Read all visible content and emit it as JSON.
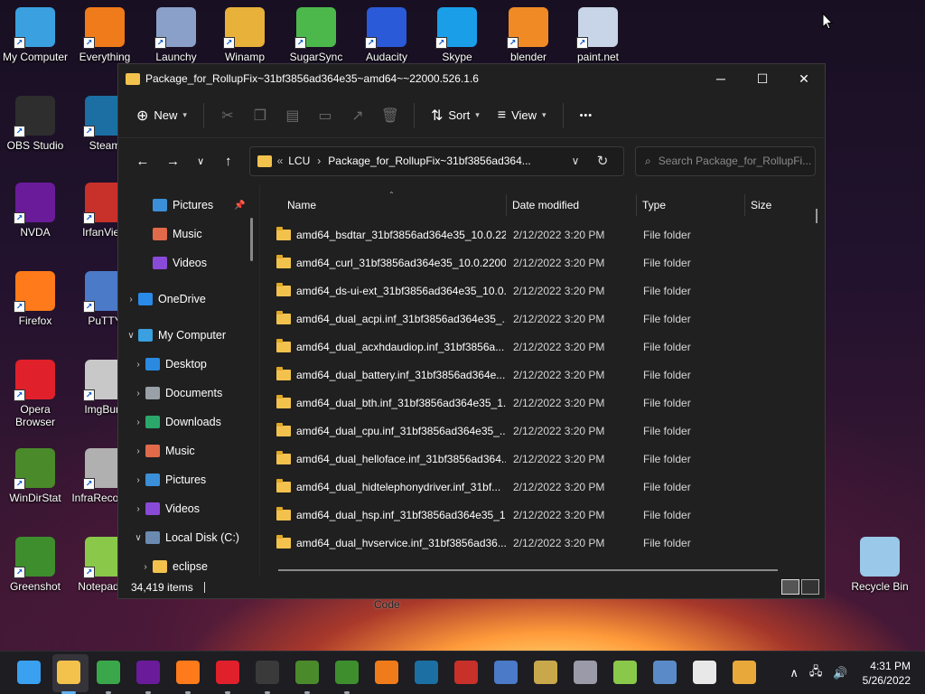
{
  "desktop_icons": [
    {
      "label": "My Computer",
      "icon": "monitor-icon",
      "color": "#3aa0e0"
    },
    {
      "label": "Everything",
      "icon": "magnifier-icon",
      "color": "#f07b1a"
    },
    {
      "label": "Launchy",
      "icon": "rocket-icon",
      "color": "#8aa0c8"
    },
    {
      "label": "Winamp",
      "icon": "lightning-icon",
      "color": "#e8b13a"
    },
    {
      "label": "SugarSync",
      "icon": "hummingbird-icon",
      "color": "#4cb84c"
    },
    {
      "label": "Audacity",
      "icon": "headphones-icon",
      "color": "#2a5ad8"
    },
    {
      "label": "Skype",
      "icon": "skype-icon",
      "color": "#1a9ee8"
    },
    {
      "label": "blender",
      "icon": "blender-icon",
      "color": "#f08a24"
    },
    {
      "label": "paint.net",
      "icon": "paint-icon",
      "color": "#c8d4e8"
    },
    {
      "label": "OBS Studio",
      "icon": "obs-icon",
      "color": "#2e2e2e"
    },
    {
      "label": "Steam",
      "icon": "steam-icon",
      "color": "#1b6fa3"
    },
    {
      "label": "NVDA",
      "icon": "nvda-icon",
      "color": "#6a1b9a"
    },
    {
      "label": "IrfanView",
      "icon": "irfanview-icon",
      "color": "#c8302a"
    },
    {
      "label": "Firefox",
      "icon": "firefox-icon",
      "color": "#ff7a1a"
    },
    {
      "label": "PuTTY",
      "icon": "putty-icon",
      "color": "#4a7ac8"
    },
    {
      "label": "Opera Browser",
      "icon": "opera-icon",
      "color": "#e0202a"
    },
    {
      "label": "ImgBurn",
      "icon": "disc-icon",
      "color": "#c8c8c8"
    },
    {
      "label": "WinDirStat",
      "icon": "tree-icon",
      "color": "#4a8a2a"
    },
    {
      "label": "InfraRecorder",
      "icon": "infrarecorder-icon",
      "color": "#b0b0b0"
    },
    {
      "label": "Greenshot",
      "icon": "greenshot-icon",
      "color": "#3e8e2e"
    },
    {
      "label": "Notepad++",
      "icon": "notepad-icon",
      "color": "#8ac84a"
    },
    {
      "label": "Recycle Bin",
      "icon": "recycle-bin-icon",
      "color": "#9ac8e8"
    }
  ],
  "window": {
    "title": "Package_for_RollupFix~31bf3856ad364e35~amd64~~22000.526.1.6",
    "minimize": "─",
    "maximize": "☐",
    "close": "✕"
  },
  "toolbar": {
    "new_label": "New",
    "sort_label": "Sort",
    "view_label": "View",
    "more_label": "•••"
  },
  "address": {
    "overflow": "«",
    "crumbs": [
      "LCU",
      "Package_for_RollupFix~31bf3856ad364..."
    ],
    "search_placeholder": "Search Package_for_RollupFi..."
  },
  "nav": [
    {
      "label": "Pictures",
      "icon": "pictures-icon",
      "color": "#3a8fd8",
      "pinned": true
    },
    {
      "label": "Music",
      "icon": "music-icon",
      "color": "#e06a4a"
    },
    {
      "label": "Videos",
      "icon": "videos-icon",
      "color": "#8a4ad8"
    },
    {
      "label": "OneDrive",
      "icon": "cloud-icon",
      "color": "#2a8ae8"
    },
    {
      "label": "My Computer",
      "icon": "monitor-icon",
      "color": "#3aa0e0"
    },
    {
      "label": "Desktop",
      "icon": "desktop-icon",
      "color": "#2a8ae0"
    },
    {
      "label": "Documents",
      "icon": "documents-icon",
      "color": "#9aa0a8"
    },
    {
      "label": "Downloads",
      "icon": "downloads-icon",
      "color": "#2aa86a"
    },
    {
      "label": "Music",
      "icon": "music-icon",
      "color": "#e06a4a"
    },
    {
      "label": "Pictures",
      "icon": "pictures-icon",
      "color": "#3a8fd8"
    },
    {
      "label": "Videos",
      "icon": "videos-icon",
      "color": "#8a4ad8"
    },
    {
      "label": "Local Disk (C:)",
      "icon": "drive-icon",
      "color": "#6a8ab0"
    },
    {
      "label": "eclipse",
      "icon": "folder-icon",
      "color": "#f2c24d"
    }
  ],
  "columns": {
    "name": "Name",
    "date": "Date modified",
    "type": "Type",
    "size": "Size"
  },
  "files": [
    {
      "name": "amd64_bsdtar_31bf3856ad364e35_10.0.22...",
      "date": "2/12/2022 3:20 PM",
      "type": "File folder"
    },
    {
      "name": "amd64_curl_31bf3856ad364e35_10.0.2200...",
      "date": "2/12/2022 3:20 PM",
      "type": "File folder"
    },
    {
      "name": "amd64_ds-ui-ext_31bf3856ad364e35_10.0...",
      "date": "2/12/2022 3:20 PM",
      "type": "File folder"
    },
    {
      "name": "amd64_dual_acpi.inf_31bf3856ad364e35_...",
      "date": "2/12/2022 3:20 PM",
      "type": "File folder"
    },
    {
      "name": "amd64_dual_acxhdaudiop.inf_31bf3856a...",
      "date": "2/12/2022 3:20 PM",
      "type": "File folder"
    },
    {
      "name": "amd64_dual_battery.inf_31bf3856ad364e...",
      "date": "2/12/2022 3:20 PM",
      "type": "File folder"
    },
    {
      "name": "amd64_dual_bth.inf_31bf3856ad364e35_1...",
      "date": "2/12/2022 3:20 PM",
      "type": "File folder"
    },
    {
      "name": "amd64_dual_cpu.inf_31bf3856ad364e35_...",
      "date": "2/12/2022 3:20 PM",
      "type": "File folder"
    },
    {
      "name": "amd64_dual_helloface.inf_31bf3856ad364...",
      "date": "2/12/2022 3:20 PM",
      "type": "File folder"
    },
    {
      "name": "amd64_dual_hidtelephonydriver.inf_31bf...",
      "date": "2/12/2022 3:20 PM",
      "type": "File folder"
    },
    {
      "name": "amd64_dual_hsp.inf_31bf3856ad364e35_1...",
      "date": "2/12/2022 3:20 PM",
      "type": "File folder"
    },
    {
      "name": "amd64_dual_hvservice.inf_31bf3856ad36...",
      "date": "2/12/2022 3:20 PM",
      "type": "File folder"
    }
  ],
  "status": {
    "items": "34,419 items"
  },
  "behind_window_text": "Code",
  "taskbar": {
    "apps": [
      {
        "name": "start-icon",
        "color": "#3aa0f0"
      },
      {
        "name": "file-explorer-icon",
        "color": "#f2c24d"
      },
      {
        "name": "chrome-icon",
        "color": "#3aa84a"
      },
      {
        "name": "nvda-icon",
        "color": "#6a1b9a"
      },
      {
        "name": "firefox-icon",
        "color": "#ff7a1a"
      },
      {
        "name": "opera-icon",
        "color": "#e0202a"
      },
      {
        "name": "obs-icon",
        "color": "#3a3a3a"
      },
      {
        "name": "windirstat-icon",
        "color": "#4a8a2a"
      },
      {
        "name": "greenshot-icon",
        "color": "#3e8e2e"
      },
      {
        "name": "everything-icon",
        "color": "#f07b1a"
      },
      {
        "name": "steam-icon",
        "color": "#1b6fa3"
      },
      {
        "name": "irfanview-icon",
        "color": "#c8302a"
      },
      {
        "name": "putty-icon",
        "color": "#4a7ac8"
      },
      {
        "name": "imgburn-icon",
        "color": "#c8a84a"
      },
      {
        "name": "infrarecorder-icon",
        "color": "#9a9aa8"
      },
      {
        "name": "notepadpp-icon",
        "color": "#8ac84a"
      },
      {
        "name": "mail-icon",
        "color": "#5a8ac8"
      },
      {
        "name": "vlc-icon",
        "color": "#e8e8e8"
      },
      {
        "name": "ftp-icon",
        "color": "#e8a83a"
      }
    ],
    "time": "4:31 PM",
    "date": "5/26/2022"
  }
}
